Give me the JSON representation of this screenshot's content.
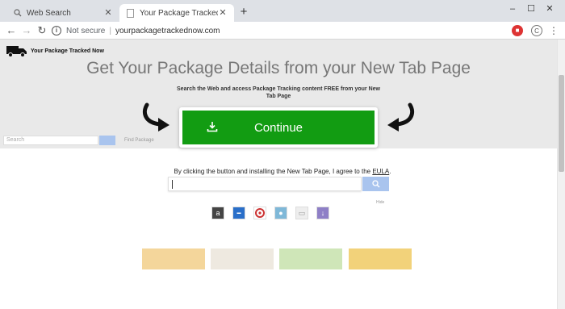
{
  "browser": {
    "tabs": [
      {
        "title": "Web Search",
        "favicon": "search-icon",
        "active": false
      },
      {
        "title": "Your Package Tracked Now",
        "favicon": "page-icon",
        "active": true
      }
    ],
    "security_label": "Not secure",
    "url": "yourpackagetrackednow.com",
    "profile_initial": "C"
  },
  "page": {
    "brand": "Your Package Tracked Now",
    "headline": "Get Your Package Details from your New Tab Page",
    "subtext": "Search the Web and access Package Tracking content FREE from your New Tab Page",
    "cta_label": "Continue",
    "search_placeholder": "Search",
    "find_package_label": "Find Package",
    "eula_text": "By clicking the button and installing the New Tab Page, I agree to the ",
    "eula_link": "EULA",
    "eula_end": ".",
    "hide_label": "Hide"
  },
  "colors": {
    "cta": "#129c12",
    "hero_bg": "#e9e9e9",
    "headline": "#777777",
    "search_button": "#a9c4ee"
  }
}
